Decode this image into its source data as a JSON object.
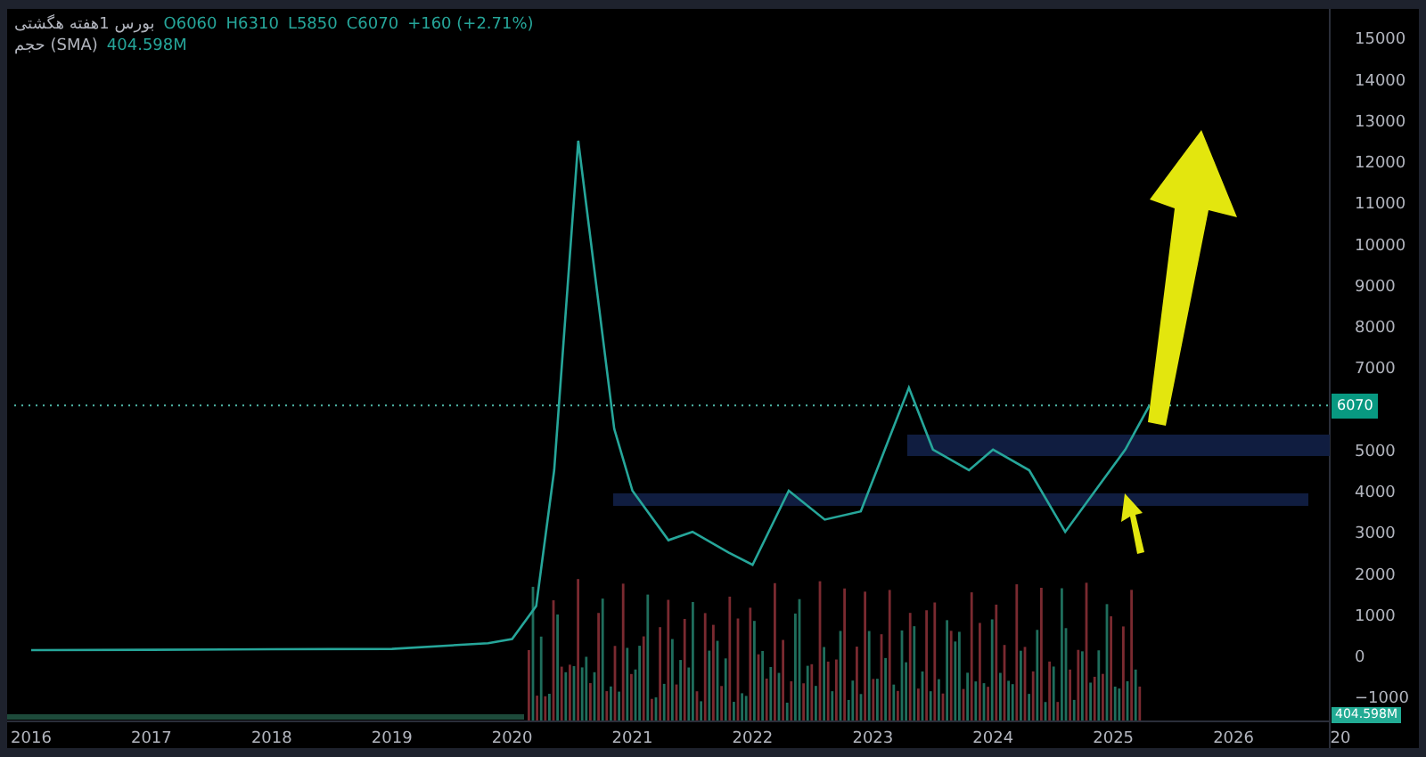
{
  "legend": {
    "symbol": "بورس 1هفته هگشتی",
    "open": "O6060",
    "high": "H6310",
    "low": "L5850",
    "close": "C6070",
    "change": "+160 (+2.71%)",
    "volume_label": "حجم (SMA)",
    "volume_value": "404.598M"
  },
  "price_tag": "6070",
  "volume_tag": "404.598M",
  "x_axis_cut_label": "20",
  "chart_data": {
    "type": "line",
    "x": [
      2016,
      2017,
      2018,
      2019,
      2019.8,
      2020.0,
      2020.2,
      2020.35,
      2020.55,
      2020.7,
      2020.85,
      2021.0,
      2021.3,
      2021.5,
      2021.8,
      2022.0,
      2022.3,
      2022.6,
      2022.9,
      2023.1,
      2023.3,
      2023.5,
      2023.8,
      2024.0,
      2024.3,
      2024.6,
      2024.9,
      2025.1,
      2025.3
    ],
    "series": [
      {
        "color": "#26a69a",
        "values": [
          130,
          140,
          150,
          160,
          300,
          400,
          1200,
          4500,
          12500,
          9000,
          5500,
          4000,
          2800,
          3000,
          2500,
          2200,
          4000,
          3300,
          3500,
          5000,
          6500,
          5000,
          4500,
          5000,
          4500,
          3000,
          4200,
          5000,
          6070
        ]
      }
    ],
    "xlim": [
      2015.8,
      2026.8
    ],
    "ylim": [
      -1600,
      15700
    ],
    "xticks": [
      2016,
      2017,
      2018,
      2019,
      2020,
      2021,
      2022,
      2023,
      2024,
      2025,
      2026
    ],
    "yticks": [
      {
        "value": -1000,
        "label": "−1000"
      },
      0,
      1000,
      2000,
      3000,
      4000,
      5000,
      7000,
      8000,
      9000,
      10000,
      11000,
      12000,
      13000,
      14000,
      15000
    ],
    "ref_lines": [
      {
        "axis": "y",
        "value": 6070
      }
    ]
  }
}
